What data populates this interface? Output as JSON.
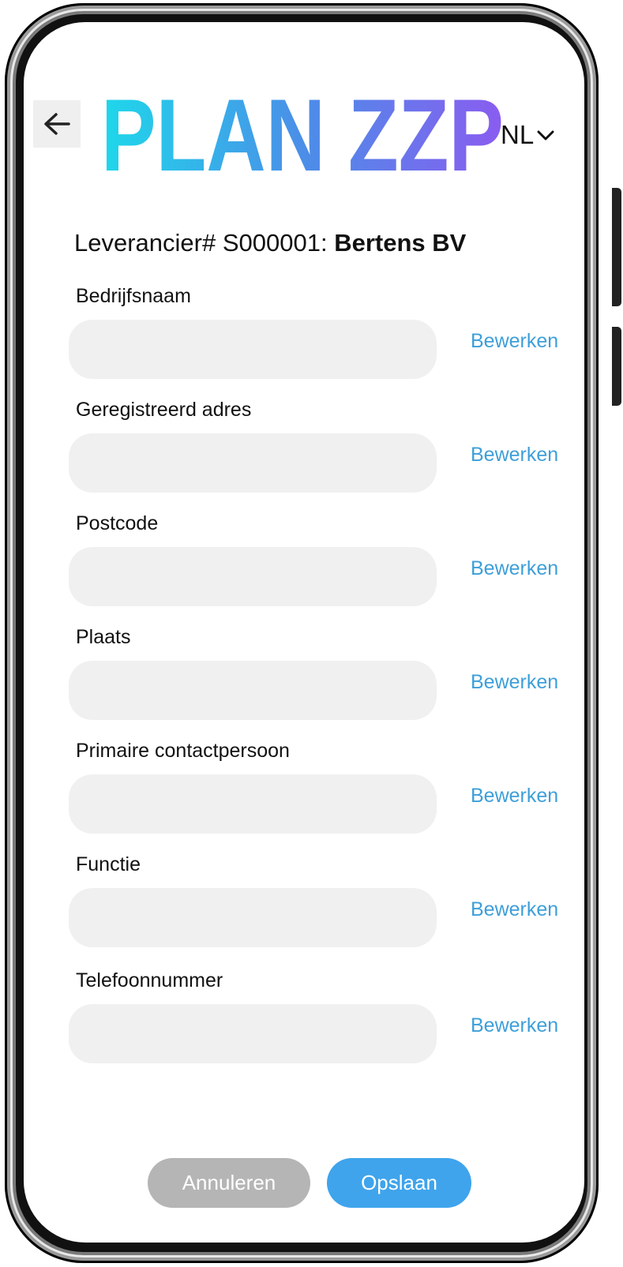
{
  "header": {
    "back_icon": "arrow-left-icon",
    "logo_text": "PLAN ZZP",
    "language": "NL",
    "language_icon": "chevron-down-icon"
  },
  "supplier": {
    "prefix": "Leverancier# S000001: ",
    "name": "Bertens BV"
  },
  "fields": [
    {
      "label": "Bedrijfsnaam",
      "value": "",
      "edit": "Bewerken"
    },
    {
      "label": "Geregistreerd adres",
      "value": "",
      "edit": "Bewerken"
    },
    {
      "label": "Postcode",
      "value": "",
      "edit": "Bewerken"
    },
    {
      "label": "Plaats",
      "value": "",
      "edit": "Bewerken"
    },
    {
      "label": "Primaire contactpersoon",
      "value": "",
      "edit": "Bewerken"
    },
    {
      "label": "Functie",
      "value": "",
      "edit": "Bewerken"
    },
    {
      "label": "Telefoonnummer",
      "value": "",
      "edit": "Bewerken"
    }
  ],
  "actions": {
    "cancel": "Annuleren",
    "save": "Opslaan"
  },
  "colors": {
    "logo_gradient_start": "#1ed8ea",
    "logo_gradient_mid": "#4b8ee8",
    "logo_gradient_end": "#8a5cf0",
    "link": "#3d9fd9",
    "save_button": "#3fa4ec",
    "cancel_button": "#b5b5b5",
    "input_background": "#f0f0f0"
  }
}
